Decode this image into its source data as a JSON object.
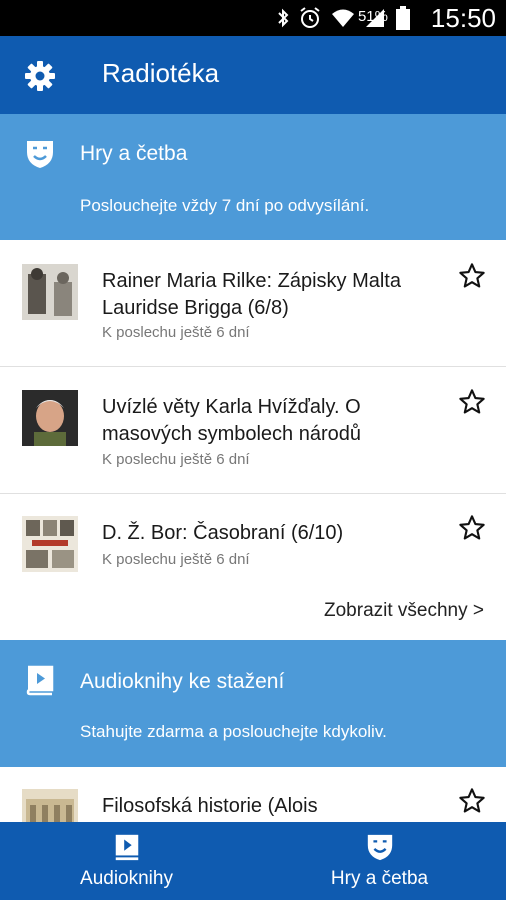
{
  "status_bar": {
    "battery_percent": "51%",
    "time": "15:50"
  },
  "app_bar": {
    "title": "Radiotéka",
    "settings_icon": "gear-icon"
  },
  "sections": [
    {
      "title": "Hry a četba",
      "subtitle": "Poslouchejte vždy 7 dní po odvysílání.",
      "icon": "theater-masks-icon",
      "items": [
        {
          "title": "Rainer Maria Rilke: Zápisky Malta Lauridse Brigga (6/8)",
          "availability": "K poslechu ještě 6 dní"
        },
        {
          "title": "Uvízlé věty Karla Hvížďaly. O masových symbolech národů",
          "availability": "K poslechu ještě 6 dní"
        },
        {
          "title": "D. Ž. Bor: Časobraní (6/10)",
          "availability": "K poslechu ještě 6 dní"
        }
      ],
      "show_all": "Zobrazit všechny >"
    },
    {
      "title": "Audioknihy ke stažení",
      "subtitle": "Stahujte zdarma a poslouchejte kdykoliv.",
      "icon": "audiobook-icon",
      "items": [
        {
          "title": "Filosofská historie (Alois"
        }
      ]
    }
  ],
  "bottom_nav": [
    {
      "label": "Audioknihy",
      "icon": "audiobook-icon"
    },
    {
      "label": "Hry a četba",
      "icon": "theater-masks-icon"
    }
  ],
  "colors": {
    "app_bar": "#0f5bb0",
    "section_header": "#4d9ad8",
    "status_bar": "#000000"
  }
}
